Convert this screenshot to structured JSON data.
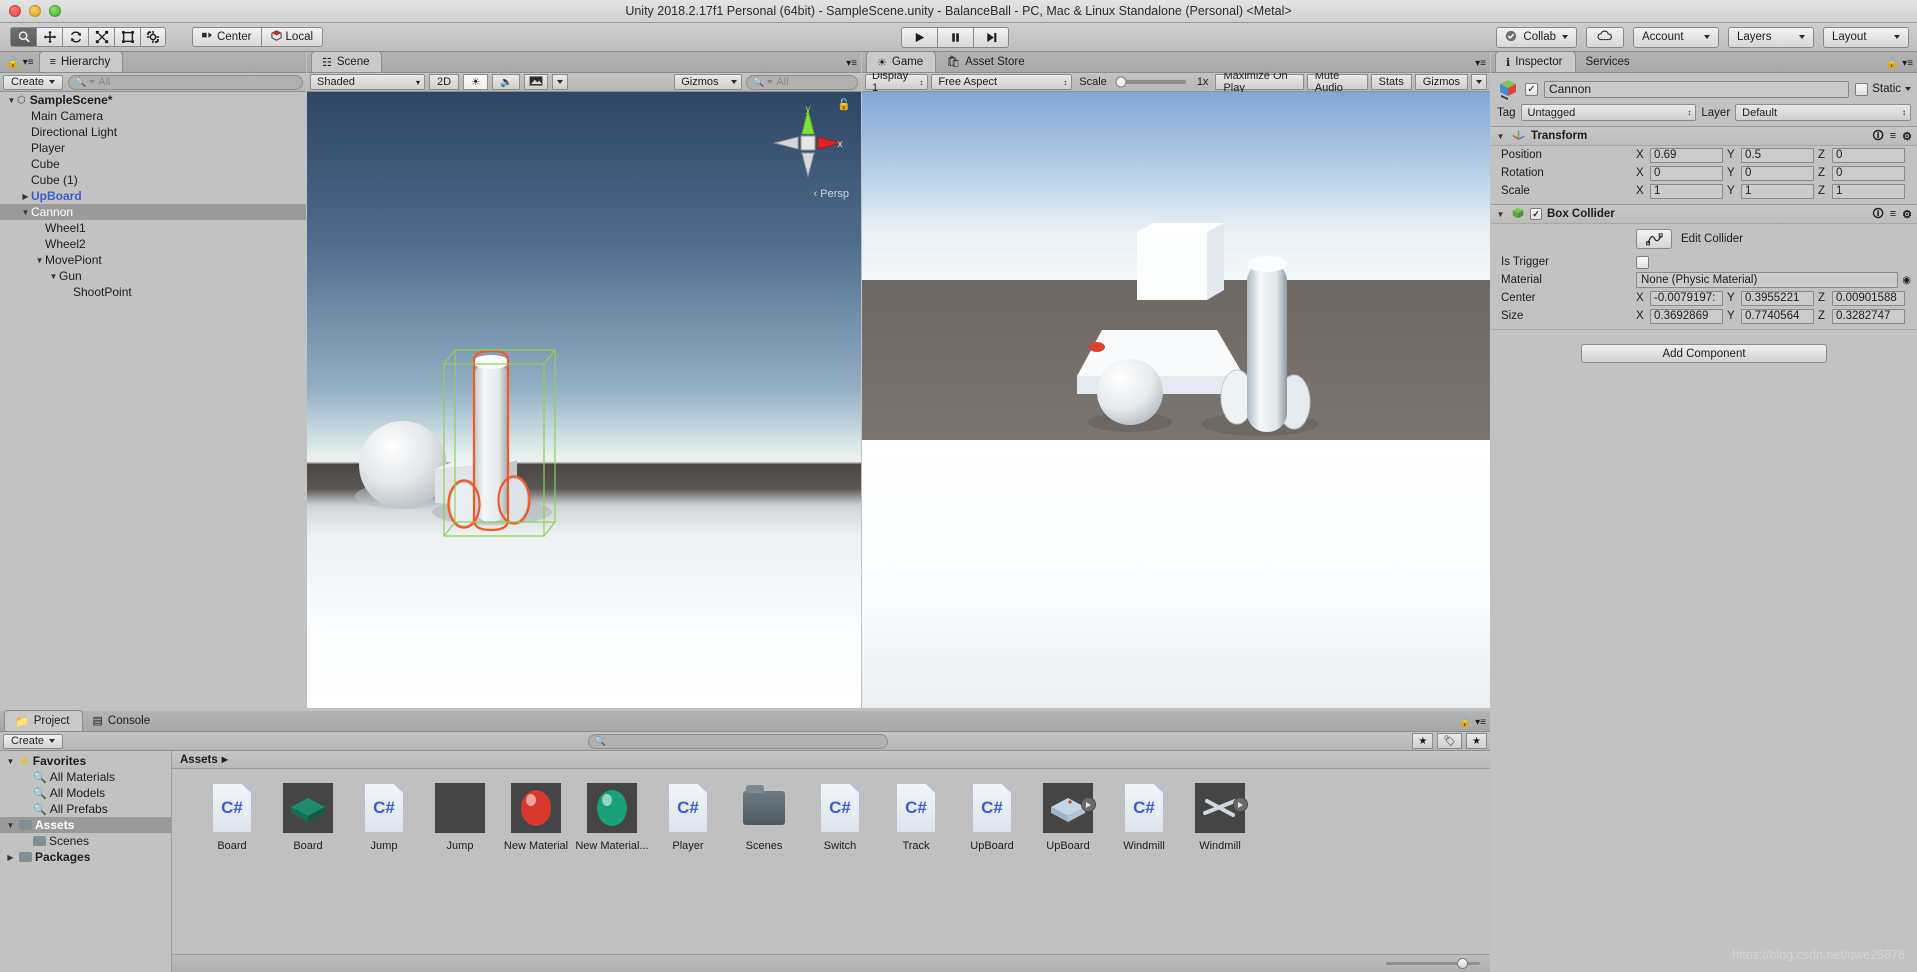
{
  "window": {
    "title": "Unity 2018.2.17f1 Personal (64bit) - SampleScene.unity - BalanceBall - PC, Mac & Linux Standalone (Personal) <Metal>"
  },
  "toolbar": {
    "tools": [
      {
        "name": "hand-tool",
        "active": true
      },
      {
        "name": "move-tool",
        "active": false
      },
      {
        "name": "rotate-tool",
        "active": false
      },
      {
        "name": "scale-tool",
        "active": false
      },
      {
        "name": "rect-tool",
        "active": false
      },
      {
        "name": "transform-tool",
        "active": false
      }
    ],
    "pivot_label": "Center",
    "space_label": "Local",
    "play_label": "play-icon",
    "pause_label": "pause-icon",
    "step_label": "step-icon",
    "collab_label": "Collab",
    "cloud_label": "cloud-icon",
    "account_label": "Account",
    "layers_label": "Layers",
    "layout_label": "Layout"
  },
  "hierarchy": {
    "tab": "Hierarchy",
    "create_label": "Create",
    "search_placeholder": "All",
    "items": [
      {
        "label": "SampleScene*",
        "depth": 0,
        "arrow": "down",
        "selected": false,
        "style": "root",
        "icon": "scene-icon"
      },
      {
        "label": "Main Camera",
        "depth": 1,
        "arrow": "",
        "selected": false,
        "style": ""
      },
      {
        "label": "Directional Light",
        "depth": 1,
        "arrow": "",
        "selected": false,
        "style": ""
      },
      {
        "label": "Player",
        "depth": 1,
        "arrow": "",
        "selected": false,
        "style": ""
      },
      {
        "label": "Cube",
        "depth": 1,
        "arrow": "",
        "selected": false,
        "style": ""
      },
      {
        "label": "Cube (1)",
        "depth": 1,
        "arrow": "",
        "selected": false,
        "style": ""
      },
      {
        "label": "UpBoard",
        "depth": 1,
        "arrow": "right",
        "selected": false,
        "style": "prefab"
      },
      {
        "label": "Cannon",
        "depth": 1,
        "arrow": "down",
        "selected": true,
        "style": ""
      },
      {
        "label": "Wheel1",
        "depth": 2,
        "arrow": "",
        "selected": false,
        "style": ""
      },
      {
        "label": "Wheel2",
        "depth": 2,
        "arrow": "",
        "selected": false,
        "style": ""
      },
      {
        "label": "MovePiont",
        "depth": 2,
        "arrow": "down",
        "selected": false,
        "style": ""
      },
      {
        "label": "Gun",
        "depth": 3,
        "arrow": "down",
        "selected": false,
        "style": ""
      },
      {
        "label": "ShootPoint",
        "depth": 4,
        "arrow": "",
        "selected": false,
        "style": ""
      }
    ]
  },
  "scene": {
    "tab": "Scene",
    "shading_mode": "Shaded",
    "mode_2d": "2D",
    "lighting_icon": "sun-icon",
    "audio_icon": "speaker-icon",
    "fx_icon": "image-icon",
    "gizmos_label": "Gizmos",
    "search_placeholder": "All",
    "axis_x": "x",
    "axis_y": "y",
    "persp_label": "Persp"
  },
  "game": {
    "tab": "Game",
    "asset_store_tab": "Asset Store",
    "display": "Display 1",
    "aspect": "Free Aspect",
    "scale_label": "Scale",
    "scale_value": "1x",
    "maximize_label": "Maximize On Play",
    "mute_label": "Mute Audio",
    "stats_label": "Stats",
    "gizmos_label": "Gizmos"
  },
  "inspector": {
    "tab": "Inspector",
    "services_tab": "Services",
    "object_name": "Cannon",
    "enabled": true,
    "static_label": "Static",
    "tag_label": "Tag",
    "tag_value": "Untagged",
    "layer_label": "Layer",
    "layer_value": "Default",
    "components": [
      {
        "name": "Transform",
        "icon": "transform-icon",
        "has_checkbox": false,
        "rows": [
          {
            "label": "Position",
            "x": "0.69",
            "y": "0.5",
            "z": "0"
          },
          {
            "label": "Rotation",
            "x": "0",
            "y": "0",
            "z": "0"
          },
          {
            "label": "Scale",
            "x": "1",
            "y": "1",
            "z": "1"
          }
        ]
      },
      {
        "name": "Box Collider",
        "icon": "collider-icon",
        "has_checkbox": true,
        "edit_collider_label": "Edit Collider",
        "is_trigger_label": "Is Trigger",
        "is_trigger_value": false,
        "material_label": "Material",
        "material_value": "None (Physic Material)",
        "rows": [
          {
            "label": "Center",
            "x": "-0.0079197:",
            "y": "0.3955221",
            "z": "0.00901588"
          },
          {
            "label": "Size",
            "x": "0.3692869",
            "y": "0.7740564",
            "z": "0.3282747"
          }
        ]
      }
    ],
    "add_component_label": "Add Component"
  },
  "project": {
    "tab": "Project",
    "console_tab": "Console",
    "create_label": "Create",
    "search_placeholder": "",
    "breadcrumb": "Assets",
    "tree": [
      {
        "label": "Favorites",
        "depth": 0,
        "arrow": "down",
        "icon": "star-icon",
        "selected": false,
        "bold": true
      },
      {
        "label": "All Materials",
        "depth": 1,
        "arrow": "",
        "icon": "search-icon",
        "selected": false,
        "bold": false
      },
      {
        "label": "All Models",
        "depth": 1,
        "arrow": "",
        "icon": "search-icon",
        "selected": false,
        "bold": false
      },
      {
        "label": "All Prefabs",
        "depth": 1,
        "arrow": "",
        "icon": "search-icon",
        "selected": false,
        "bold": false
      },
      {
        "label": "Assets",
        "depth": 0,
        "arrow": "down",
        "icon": "folder-icon",
        "selected": true,
        "bold": true
      },
      {
        "label": "Scenes",
        "depth": 1,
        "arrow": "",
        "icon": "folder-icon",
        "selected": false,
        "bold": false
      },
      {
        "label": "Packages",
        "depth": 0,
        "arrow": "right",
        "icon": "folder-icon",
        "selected": false,
        "bold": true
      }
    ],
    "assets": [
      {
        "label": "Board",
        "kind": "script"
      },
      {
        "label": "Board",
        "kind": "mesh",
        "color": "#1f8a6e"
      },
      {
        "label": "Jump",
        "kind": "script"
      },
      {
        "label": "Jump",
        "kind": "empty"
      },
      {
        "label": "New Material",
        "kind": "material",
        "color": "#d8382b"
      },
      {
        "label": "New Material...",
        "kind": "material",
        "color": "#17a07a"
      },
      {
        "label": "Player",
        "kind": "script"
      },
      {
        "label": "Scenes",
        "kind": "folder"
      },
      {
        "label": "Switch",
        "kind": "script"
      },
      {
        "label": "Track",
        "kind": "script"
      },
      {
        "label": "UpBoard",
        "kind": "script"
      },
      {
        "label": "UpBoard",
        "kind": "prefab",
        "color": "#c3d6e8"
      },
      {
        "label": "Windmill",
        "kind": "script"
      },
      {
        "label": "Windmill",
        "kind": "prefab-cross",
        "color": "#cfd8e0"
      }
    ]
  },
  "watermark": "https://blog.csdn.net/qwe25878",
  "colors": {
    "selection_outline": "#f25a25",
    "selection_box": "#8fd14f",
    "panel_bg": "#c2c2c2",
    "row_selected": "#9a9a9a",
    "prefab_blue": "#3a5fcd"
  }
}
